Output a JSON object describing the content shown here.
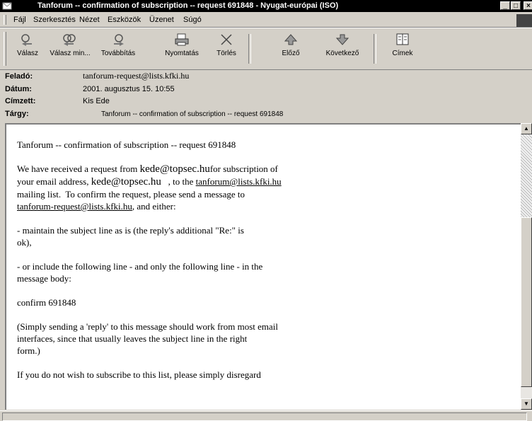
{
  "window": {
    "title": "Tanforum -- confirmation of subscription -- request 691848 - Nyugat-európai (ISO)",
    "minimize_glyph": "_",
    "restore_glyph": "□",
    "close_glyph": "×"
  },
  "menu": [
    "Fájl",
    "Szerkesztés",
    "Nézet",
    "Eszközök",
    "Üzenet",
    "Súgó"
  ],
  "toolbar": {
    "reply": "Válasz",
    "reply_all": "Válasz min...",
    "forward": "Továbbítás",
    "print": "Nyomtatás",
    "delete": "Törlés",
    "previous": "Előző",
    "next": "Következő",
    "addresses": "Címek"
  },
  "header": {
    "from_label": "Feladó:",
    "from_value": "tanforum-request@lists.kfki.hu",
    "date_label": "Dátum:",
    "date_value": "2001. augusztus 15. 10:55",
    "to_label": "Címzett:",
    "to_value": "Kis Ede",
    "subject_label": "Tárgy:",
    "subject_value": "Tanforum -- confirmation of subscription -- request 691848"
  },
  "message": {
    "p1": "Tanforum -- confirmation of subscription -- request 691848",
    "p2_a": "We have received a request from ",
    "p2_email1": "kede@topsec.hu",
    "p2_b": "for subscription of",
    "p2_c": "your email address, ",
    "p2_email2": "kede@topsec.hu",
    "p2_d": "   , to the ",
    "p2_link1": "tanforum@lists.kfki.hu",
    "p2_e": "mailing list.  To confirm the request, please send a message to",
    "p2_link2": "tanforum-request@lists.kfki.hu",
    "p2_f": ", and either:",
    "p3": "- maintain the subject line as is (the reply's additional \"Re:\" is\nok),",
    "p4": "- or include the following line - and only the following line - in the\nmessage body:",
    "p5": "confirm 691848",
    "p6": "(Simply sending a 'reply' to this message should work from most email\ninterfaces, since that usually leaves the subject line in the right\nform.)",
    "p7": "If you do not wish to subscribe to this list, please simply disregard"
  },
  "scrollbar": {
    "up_glyph": "▲",
    "down_glyph": "▼"
  }
}
